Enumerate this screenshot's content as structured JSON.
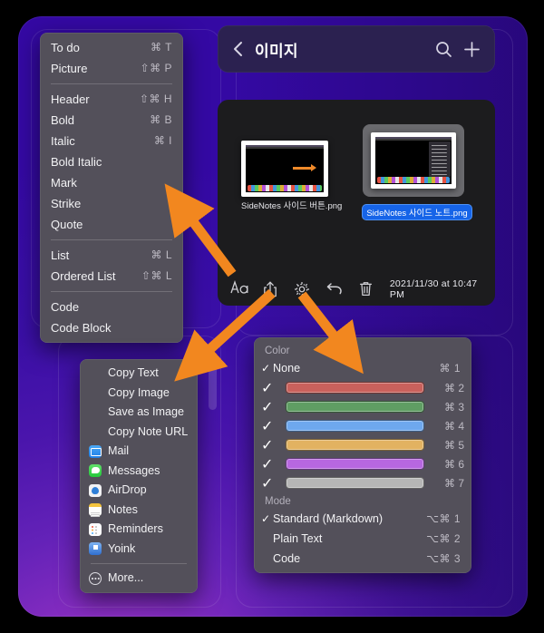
{
  "app": {
    "title": "이미지",
    "back_icon": "chevron-left-icon",
    "search_icon": "search-icon",
    "add_icon": "plus-icon"
  },
  "format_menu": {
    "groups": [
      [
        {
          "label": "To do",
          "shortcut": "⌘ T"
        },
        {
          "label": "Picture",
          "shortcut": "⇧⌘ P"
        }
      ],
      [
        {
          "label": "Header",
          "shortcut": "⇧⌘ H"
        },
        {
          "label": "Bold",
          "shortcut": "⌘ B"
        },
        {
          "label": "Italic",
          "shortcut": "⌘ I"
        },
        {
          "label": "Bold Italic",
          "shortcut": ""
        },
        {
          "label": "Mark",
          "shortcut": ""
        },
        {
          "label": "Strike",
          "shortcut": ""
        },
        {
          "label": "Quote",
          "shortcut": ""
        }
      ],
      [
        {
          "label": "List",
          "shortcut": "⌘ L"
        },
        {
          "label": "Ordered List",
          "shortcut": "⇧⌘ L"
        }
      ],
      [
        {
          "label": "Code",
          "shortcut": ""
        },
        {
          "label": "Code Block",
          "shortcut": ""
        }
      ]
    ]
  },
  "share_menu": {
    "groups": [
      [
        {
          "label": "Copy Text",
          "icon": ""
        },
        {
          "label": "Copy Image",
          "icon": ""
        },
        {
          "label": "Save as Image",
          "icon": ""
        },
        {
          "label": "Copy Note URL",
          "icon": ""
        },
        {
          "label": "Mail",
          "icon": "mail-icon"
        },
        {
          "label": "Messages",
          "icon": "messages-icon"
        },
        {
          "label": "AirDrop",
          "icon": "airdrop-icon"
        },
        {
          "label": "Notes",
          "icon": "notes-icon"
        },
        {
          "label": "Reminders",
          "icon": "reminders-icon"
        },
        {
          "label": "Yoink",
          "icon": "yoink-icon"
        }
      ],
      [
        {
          "label": "More...",
          "icon": "more-icon"
        }
      ]
    ]
  },
  "color_menu": {
    "color_header": "Color",
    "none_label": "None",
    "none_shortcut": "⌘ 1",
    "none_checked": true,
    "swatches": [
      {
        "color": "#c9615c",
        "shortcut": "⌘ 2"
      },
      {
        "color": "#5f9e63",
        "shortcut": "⌘ 3"
      },
      {
        "color": "#6ea8ee",
        "shortcut": "⌘ 4"
      },
      {
        "color": "#e2b261",
        "shortcut": "⌘ 5"
      },
      {
        "color": "#b767e0",
        "shortcut": "⌘ 6"
      },
      {
        "color": "#b6b6b6",
        "shortcut": "⌘ 7"
      }
    ],
    "mode_header": "Mode",
    "modes": [
      {
        "label": "Standard (Markdown)",
        "shortcut": "⌥⌘ 1",
        "checked": true
      },
      {
        "label": "Plain Text",
        "shortcut": "⌥⌘ 2",
        "checked": false
      },
      {
        "label": "Code",
        "shortcut": "⌥⌘ 3",
        "checked": false
      }
    ]
  },
  "image_panel": {
    "items": [
      {
        "filename": "SideNotes 사이드 버튼.png",
        "selected": false
      },
      {
        "filename": "SideNotes 사이드 노트.png",
        "selected": true
      }
    ],
    "toolbar": {
      "format_icon": "aa-text-icon",
      "share_icon": "share-icon",
      "settings_icon": "gear-icon",
      "undo_icon": "undo-arrow-icon",
      "delete_icon": "trash-icon",
      "date": "2021/11/30 at 10:47 PM"
    }
  },
  "annotations": {
    "accent_color": "#f2871f",
    "arrows": [
      {
        "name": "arrow-to-format-menu",
        "from": "aa-text-icon",
        "to": "format-menu"
      },
      {
        "name": "arrow-to-share-menu",
        "from": "share-icon",
        "to": "share-menu"
      },
      {
        "name": "arrow-to-color-menu",
        "from": "gear-icon",
        "to": "color-menu"
      }
    ]
  }
}
